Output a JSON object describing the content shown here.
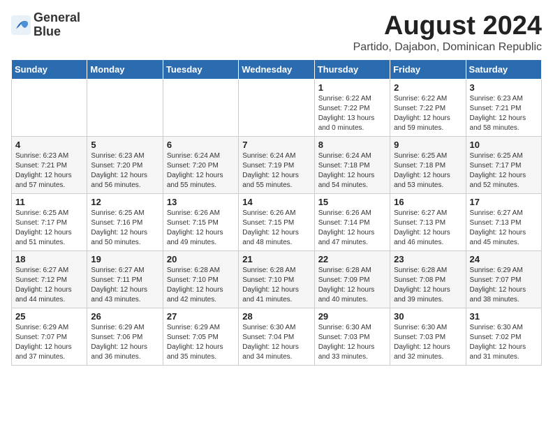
{
  "logo": {
    "line1": "General",
    "line2": "Blue"
  },
  "title": "August 2024",
  "subtitle": "Partido, Dajabon, Dominican Republic",
  "weekdays": [
    "Sunday",
    "Monday",
    "Tuesday",
    "Wednesday",
    "Thursday",
    "Friday",
    "Saturday"
  ],
  "weeks": [
    [
      {
        "day": "",
        "info": ""
      },
      {
        "day": "",
        "info": ""
      },
      {
        "day": "",
        "info": ""
      },
      {
        "day": "",
        "info": ""
      },
      {
        "day": "1",
        "info": "Sunrise: 6:22 AM\nSunset: 7:22 PM\nDaylight: 13 hours\nand 0 minutes."
      },
      {
        "day": "2",
        "info": "Sunrise: 6:22 AM\nSunset: 7:22 PM\nDaylight: 12 hours\nand 59 minutes."
      },
      {
        "day": "3",
        "info": "Sunrise: 6:23 AM\nSunset: 7:21 PM\nDaylight: 12 hours\nand 58 minutes."
      }
    ],
    [
      {
        "day": "4",
        "info": "Sunrise: 6:23 AM\nSunset: 7:21 PM\nDaylight: 12 hours\nand 57 minutes."
      },
      {
        "day": "5",
        "info": "Sunrise: 6:23 AM\nSunset: 7:20 PM\nDaylight: 12 hours\nand 56 minutes."
      },
      {
        "day": "6",
        "info": "Sunrise: 6:24 AM\nSunset: 7:20 PM\nDaylight: 12 hours\nand 55 minutes."
      },
      {
        "day": "7",
        "info": "Sunrise: 6:24 AM\nSunset: 7:19 PM\nDaylight: 12 hours\nand 55 minutes."
      },
      {
        "day": "8",
        "info": "Sunrise: 6:24 AM\nSunset: 7:18 PM\nDaylight: 12 hours\nand 54 minutes."
      },
      {
        "day": "9",
        "info": "Sunrise: 6:25 AM\nSunset: 7:18 PM\nDaylight: 12 hours\nand 53 minutes."
      },
      {
        "day": "10",
        "info": "Sunrise: 6:25 AM\nSunset: 7:17 PM\nDaylight: 12 hours\nand 52 minutes."
      }
    ],
    [
      {
        "day": "11",
        "info": "Sunrise: 6:25 AM\nSunset: 7:17 PM\nDaylight: 12 hours\nand 51 minutes."
      },
      {
        "day": "12",
        "info": "Sunrise: 6:25 AM\nSunset: 7:16 PM\nDaylight: 12 hours\nand 50 minutes."
      },
      {
        "day": "13",
        "info": "Sunrise: 6:26 AM\nSunset: 7:15 PM\nDaylight: 12 hours\nand 49 minutes."
      },
      {
        "day": "14",
        "info": "Sunrise: 6:26 AM\nSunset: 7:15 PM\nDaylight: 12 hours\nand 48 minutes."
      },
      {
        "day": "15",
        "info": "Sunrise: 6:26 AM\nSunset: 7:14 PM\nDaylight: 12 hours\nand 47 minutes."
      },
      {
        "day": "16",
        "info": "Sunrise: 6:27 AM\nSunset: 7:13 PM\nDaylight: 12 hours\nand 46 minutes."
      },
      {
        "day": "17",
        "info": "Sunrise: 6:27 AM\nSunset: 7:13 PM\nDaylight: 12 hours\nand 45 minutes."
      }
    ],
    [
      {
        "day": "18",
        "info": "Sunrise: 6:27 AM\nSunset: 7:12 PM\nDaylight: 12 hours\nand 44 minutes."
      },
      {
        "day": "19",
        "info": "Sunrise: 6:27 AM\nSunset: 7:11 PM\nDaylight: 12 hours\nand 43 minutes."
      },
      {
        "day": "20",
        "info": "Sunrise: 6:28 AM\nSunset: 7:10 PM\nDaylight: 12 hours\nand 42 minutes."
      },
      {
        "day": "21",
        "info": "Sunrise: 6:28 AM\nSunset: 7:10 PM\nDaylight: 12 hours\nand 41 minutes."
      },
      {
        "day": "22",
        "info": "Sunrise: 6:28 AM\nSunset: 7:09 PM\nDaylight: 12 hours\nand 40 minutes."
      },
      {
        "day": "23",
        "info": "Sunrise: 6:28 AM\nSunset: 7:08 PM\nDaylight: 12 hours\nand 39 minutes."
      },
      {
        "day": "24",
        "info": "Sunrise: 6:29 AM\nSunset: 7:07 PM\nDaylight: 12 hours\nand 38 minutes."
      }
    ],
    [
      {
        "day": "25",
        "info": "Sunrise: 6:29 AM\nSunset: 7:07 PM\nDaylight: 12 hours\nand 37 minutes."
      },
      {
        "day": "26",
        "info": "Sunrise: 6:29 AM\nSunset: 7:06 PM\nDaylight: 12 hours\nand 36 minutes."
      },
      {
        "day": "27",
        "info": "Sunrise: 6:29 AM\nSunset: 7:05 PM\nDaylight: 12 hours\nand 35 minutes."
      },
      {
        "day": "28",
        "info": "Sunrise: 6:30 AM\nSunset: 7:04 PM\nDaylight: 12 hours\nand 34 minutes."
      },
      {
        "day": "29",
        "info": "Sunrise: 6:30 AM\nSunset: 7:03 PM\nDaylight: 12 hours\nand 33 minutes."
      },
      {
        "day": "30",
        "info": "Sunrise: 6:30 AM\nSunset: 7:03 PM\nDaylight: 12 hours\nand 32 minutes."
      },
      {
        "day": "31",
        "info": "Sunrise: 6:30 AM\nSunset: 7:02 PM\nDaylight: 12 hours\nand 31 minutes."
      }
    ]
  ]
}
